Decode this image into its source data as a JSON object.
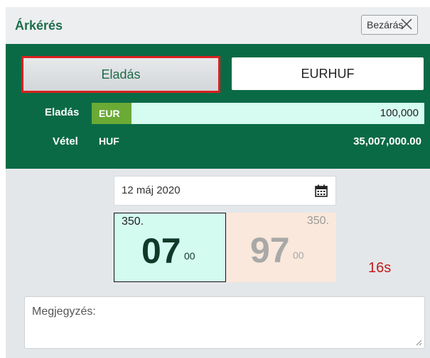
{
  "header": {
    "title": "Árkérés",
    "close_label": "Bezárás"
  },
  "trade": {
    "side_label": "Eladás",
    "pair_label": "EURHUF",
    "sell_label": "Eladás",
    "sell_currency": "EUR",
    "sell_amount": "100,000",
    "buy_label": "Vétel",
    "buy_currency": "HUF",
    "buy_amount": "35,007,000.00"
  },
  "date": {
    "value": "12 máj 2020"
  },
  "quote": {
    "bid_prefix": "350.",
    "bid_big": "07",
    "bid_pip": "00",
    "ask_prefix": "350.",
    "ask_big": "97",
    "ask_pip": "00"
  },
  "timer": "16s",
  "note": {
    "placeholder": "Megjegyzés:"
  },
  "colors": {
    "green": "#0a6a46",
    "accent_green": "#6aaa35",
    "bid_bg": "#d4fbf0",
    "ask_bg": "#f9e8db",
    "timer_red": "#c21b1b",
    "highlight_border": "#d8201f"
  }
}
